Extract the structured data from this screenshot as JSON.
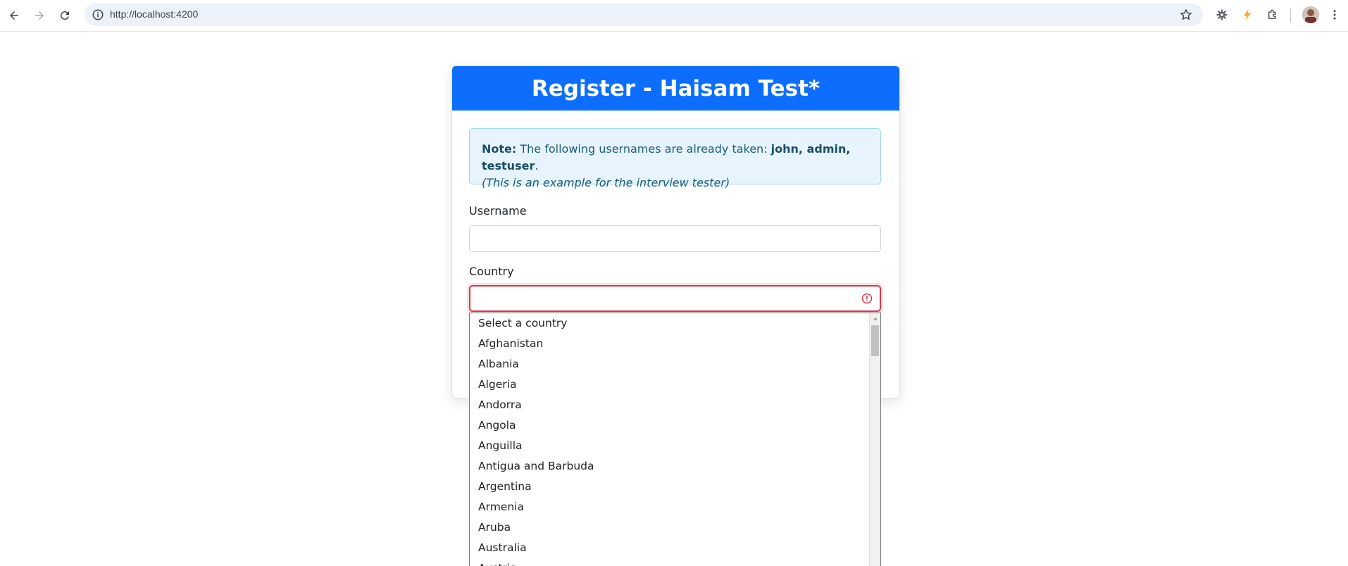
{
  "browser": {
    "url": "http://localhost:4200",
    "icons": [
      "back-arrow-icon",
      "forward-arrow-icon",
      "reload-icon",
      "info-icon",
      "star-icon",
      "extension-gear-icon",
      "extension-lightning-icon",
      "puzzle-icon",
      "menu-kebab-icon"
    ]
  },
  "card": {
    "title": "Register - Haisam Test*",
    "alert": {
      "note_label": "Note:",
      "text": " The following usernames are already taken: ",
      "names": "john, admin, testuser",
      "period": ".",
      "example": "(This is an example for the interview tester)"
    },
    "username": {
      "label": "Username",
      "value": ""
    },
    "country": {
      "label": "Country",
      "value": ""
    }
  },
  "dropdown": {
    "options": [
      "Select a country",
      "Afghanistan",
      "Albania",
      "Algeria",
      "Andorra",
      "Angola",
      "Anguilla",
      "Antigua and Barbuda",
      "Argentina",
      "Armenia",
      "Aruba",
      "Australia",
      "Austria"
    ]
  },
  "colors": {
    "primary": "#0d6efd",
    "alert_bg": "#e7f4fd",
    "invalid": "#dc3545"
  }
}
